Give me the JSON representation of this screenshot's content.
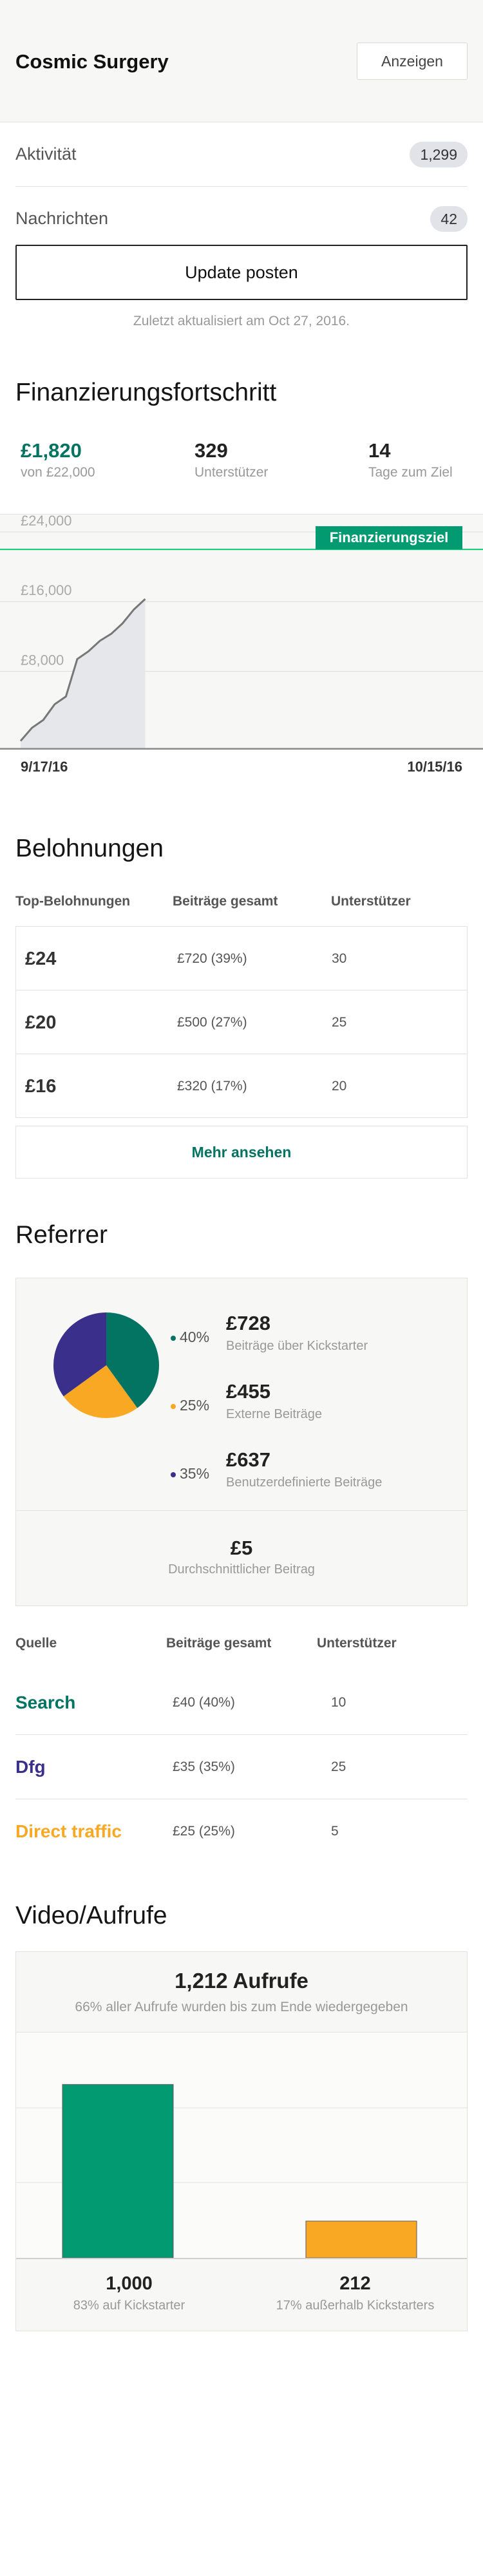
{
  "header": {
    "project_title": "Cosmic Surgery",
    "view_label": "Anzeigen"
  },
  "stats": {
    "activity_label": "Aktivität",
    "activity_count": "1,299",
    "messages_label": "Nachrichten",
    "messages_count": "42"
  },
  "post_update_label": "Update posten",
  "last_updated": "Zuletzt aktualisiert am Oct 27, 2016.",
  "funding": {
    "title": "Finanzierungsfortschritt",
    "pledged": "£1,820",
    "goal_text": "von £22,000",
    "backers": "329",
    "backers_label": "Unterstützer",
    "days": "14",
    "days_label": "Tage zum Ziel",
    "goal_label": "Finanzierungsziel",
    "start_date": "9/17/16",
    "end_date": "10/15/16"
  },
  "chart_data": {
    "type": "area",
    "title": "",
    "xlabel": "",
    "ylabel": "",
    "x_start": "9/17/16",
    "x_end": "10/15/16",
    "x_index": [
      0,
      1,
      2,
      3,
      4,
      5,
      6,
      7,
      8,
      9,
      10,
      11
    ],
    "values": [
      0,
      1500,
      2400,
      4200,
      5100,
      9400,
      10300,
      11500,
      12300,
      13500,
      15100,
      16300
    ],
    "y_ticks": [
      "£8,000",
      "£16,000",
      "£24,000"
    ],
    "y_tick_values": [
      8000,
      16000,
      24000
    ],
    "ylim": [
      -1000,
      26000
    ],
    "goal_value": 22000,
    "grid": true,
    "colors": {
      "fill": "#e6e7ea",
      "line": "#777777",
      "goal": "#05ce78"
    }
  },
  "rewards": {
    "title": "Belohnungen",
    "headers": [
      "Top-Belohnungen",
      "Beiträge gesamt",
      "Unterstützer"
    ],
    "rows": [
      {
        "amount": "£24",
        "total": "£720 (39%)",
        "backers": "30"
      },
      {
        "amount": "£20",
        "total": "£500 (27%)",
        "backers": "25"
      },
      {
        "amount": "£16",
        "total": "£320 (17%)",
        "backers": "20"
      }
    ],
    "more_label": "Mehr ansehen"
  },
  "referrers": {
    "title": "Referrer",
    "pie": [
      {
        "pct": "40%",
        "value": 40,
        "amount": "£728",
        "label": "Beiträge über Kickstarter",
        "color": "#037362"
      },
      {
        "pct": "25%",
        "value": 25,
        "amount": "£455",
        "label": "Externe Beiträge",
        "color": "#f9a824"
      },
      {
        "pct": "35%",
        "value": 35,
        "amount": "£637",
        "label": "Benutzerdefinierte Beiträge",
        "color": "#3a2f8a"
      }
    ],
    "average_value": "£5",
    "average_label": "Durchschnittlicher Beitrag",
    "headers": [
      "Quelle",
      "Beiträge gesamt",
      "Unterstützer"
    ],
    "rows": [
      {
        "name": "Search",
        "total": "£40 (40%)",
        "backers": "10",
        "color": "#037362"
      },
      {
        "name": "Dfg",
        "total": "£35 (35%)",
        "backers": "25",
        "color": "#3a2f8a"
      },
      {
        "name": "Direct traffic",
        "total": "£25 (25%)",
        "backers": "5",
        "color": "#f9a824"
      }
    ]
  },
  "video": {
    "title": "Video/Aufrufe",
    "views": "1,212 Aufrufe",
    "completion": "66% aller Aufrufe wurden bis zum Ende wiedergegeben",
    "internal_value": "1,000",
    "internal_label": "83% auf Kickstarter",
    "external_value": "212",
    "external_label": "17% außerhalb Kickstarters",
    "bars": [
      {
        "value": 1000,
        "color": "#029a71"
      },
      {
        "value": 212,
        "color": "#f9a824"
      }
    ],
    "ylim": [
      0,
      1300
    ]
  }
}
